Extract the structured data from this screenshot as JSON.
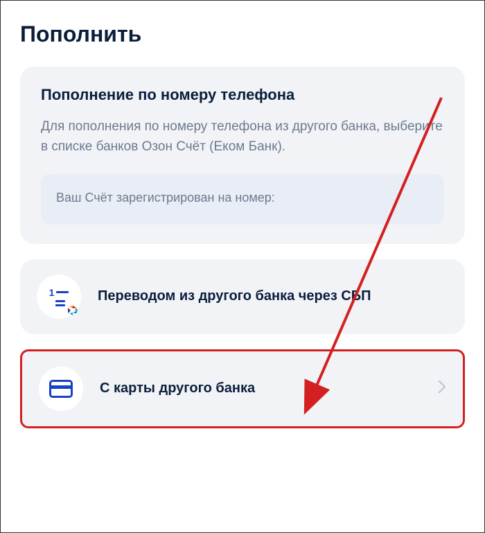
{
  "page": {
    "title": "Пополнить"
  },
  "phone_section": {
    "title": "Пополнение по номеру телефона",
    "description": "Для пополнения по номеру телефона из другого банка, выберите в списке банков Озон Счёт (Еком Банк).",
    "info": "Ваш Счёт зарегистрирован на номер:"
  },
  "options": {
    "sbp": {
      "label": "Переводом из другого банка через СБП"
    },
    "card": {
      "label": "С карты другого банка"
    }
  }
}
